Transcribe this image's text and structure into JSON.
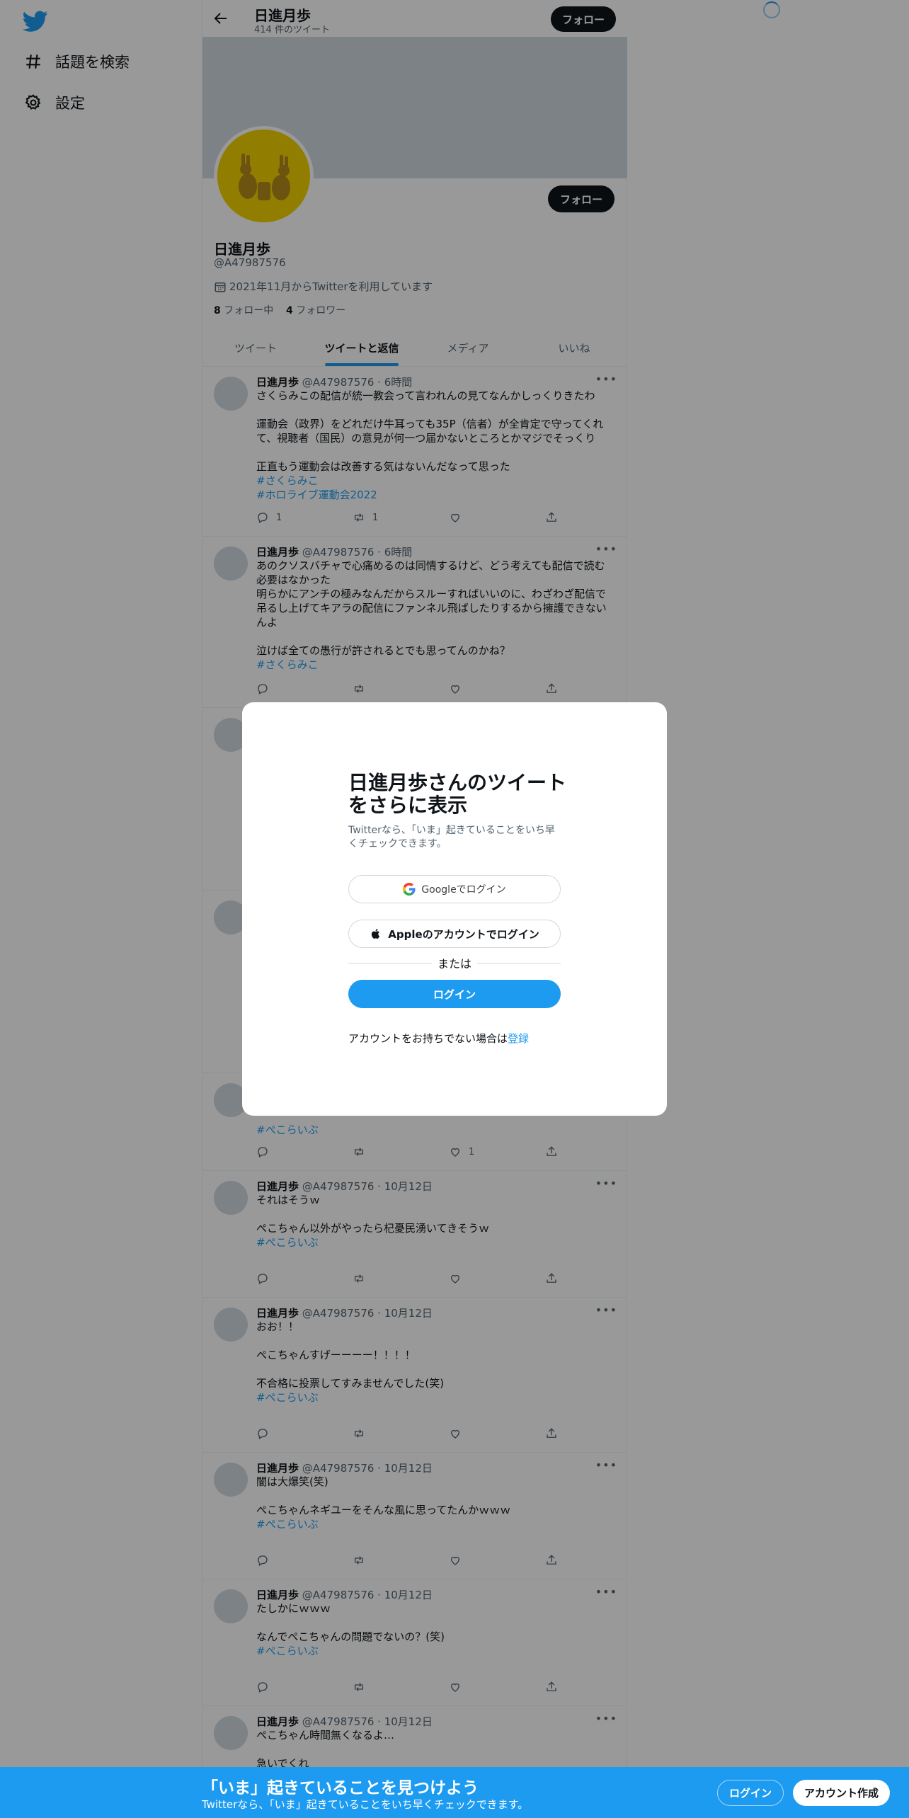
{
  "nav": {
    "items": [
      {
        "label": "話題を検索",
        "icon": "hashtag-icon"
      },
      {
        "label": "設定",
        "icon": "gear-icon"
      }
    ]
  },
  "topbar": {
    "name": "日進月歩",
    "tweet_count": "414 件のツイート",
    "follow_label": "フォロー"
  },
  "profile": {
    "name": "日進月歩",
    "handle": "@A47987576",
    "joined": "2021年11月からTwitterを利用しています",
    "following_count": "8",
    "following_label": "フォロー中",
    "followers_count": "4",
    "followers_label": "フォロワー",
    "follow_label": "フォロー"
  },
  "tabs": [
    {
      "label": "ツイート"
    },
    {
      "label": "ツイートと返信"
    },
    {
      "label": "メディア"
    },
    {
      "label": "いいね"
    }
  ],
  "tweets": [
    {
      "name": "日進月歩",
      "meta": "@A47987576 · 6時間",
      "text": "さくらみこの配信が統一教会って言われんの見てなんかしっくりきたわ\n\n運動会（政界）をどれだけ牛耳っても35P（信者）が全肯定で守ってくれて、視聴者（国民）の意見が何一つ届かないところとかマジでそっくり\n\n正直もう運動会は改善する気はないんだなって思った",
      "tags": [
        "#さくらみこ",
        "#ホロライブ運動会2022"
      ],
      "reply": "1",
      "retweet": "1",
      "like": ""
    },
    {
      "name": "日進月歩",
      "meta": "@A47987576 · 6時間",
      "text": "あのクソスバチャで心痛めるのは同情するけど、どう考えても配信で読む必要はなかった\n明らかにアンチの極みなんだからスルーすればいいのに、わざわざ配信で吊るし上げてキアラの配信にファンネル飛ばしたりするから擁護できないんよ\n\n泣けば全ての愚行が許されるとでも思ってんのかね？",
      "tags": [
        "#さくらみこ"
      ],
      "reply": "",
      "retweet": "",
      "like": ""
    },
    {
      "name": "",
      "meta": "",
      "text": "",
      "tags": [
        "#ぺこらいぶ"
      ],
      "reply": "",
      "retweet": "",
      "like": "1"
    },
    {
      "name": "日進月歩",
      "meta": "@A47987576 · 10月12日",
      "text": "それはそうｗ\n\nぺこちゃん以外がやったら杞憂民湧いてきそうｗ",
      "tags": [
        "#ぺこらいぶ"
      ],
      "reply": "",
      "retweet": "",
      "like": ""
    },
    {
      "name": "日進月歩",
      "meta": "@A47987576 · 10月12日",
      "text": "おお！！\n\nぺこちゃんすげーーーー！！！！\n\n不合格に投票してすみませんでした(笑)",
      "tags": [
        "#ぺこらいぶ"
      ],
      "reply": "",
      "retweet": "",
      "like": ""
    },
    {
      "name": "日進月歩",
      "meta": "@A47987576 · 10月12日",
      "text": "闇は大爆笑(笑)\n\nぺこちゃんネギユーをそんな風に思ってたんかｗｗｗ",
      "tags": [
        "#ぺこらいぶ"
      ],
      "reply": "",
      "retweet": "",
      "like": ""
    },
    {
      "name": "日進月歩",
      "meta": "@A47987576 · 10月12日",
      "text": "たしかにｗｗｗ\n\nなんでぺこちゃんの問題でないの？(笑)",
      "tags": [
        "#ぺこらいぶ"
      ],
      "reply": "",
      "retweet": "",
      "like": ""
    },
    {
      "name": "日進月歩",
      "meta": "@A47987576 · 10月12日",
      "text": "ぺこちゃん時間無くなるよ…\n\n急いでくれ",
      "tags": [],
      "reply": "",
      "retweet": "",
      "like": ""
    }
  ],
  "modal": {
    "title": "日進月歩さんのツイートをさらに表示",
    "subtitle": "Twitterなら、「いま」起きていることをいち早くチェックできます。",
    "google_label": "Googleでログイン",
    "apple_label": "Appleのアカウントでログイン",
    "or_label": "または",
    "login_label": "ログイン",
    "signup_prefix": "アカウントをお持ちでない場合は",
    "signup_link": "登録"
  },
  "bottom_bar": {
    "title": "「いま」起きていることを見つけよう",
    "subtitle": "Twitterなら、「いま」起きていることをいち早くチェックできます。",
    "login_label": "ログイン",
    "signup_label": "アカウント作成"
  },
  "colors": {
    "accent": "#1d9bf0",
    "text": "#0f1419",
    "muted": "#536471"
  }
}
